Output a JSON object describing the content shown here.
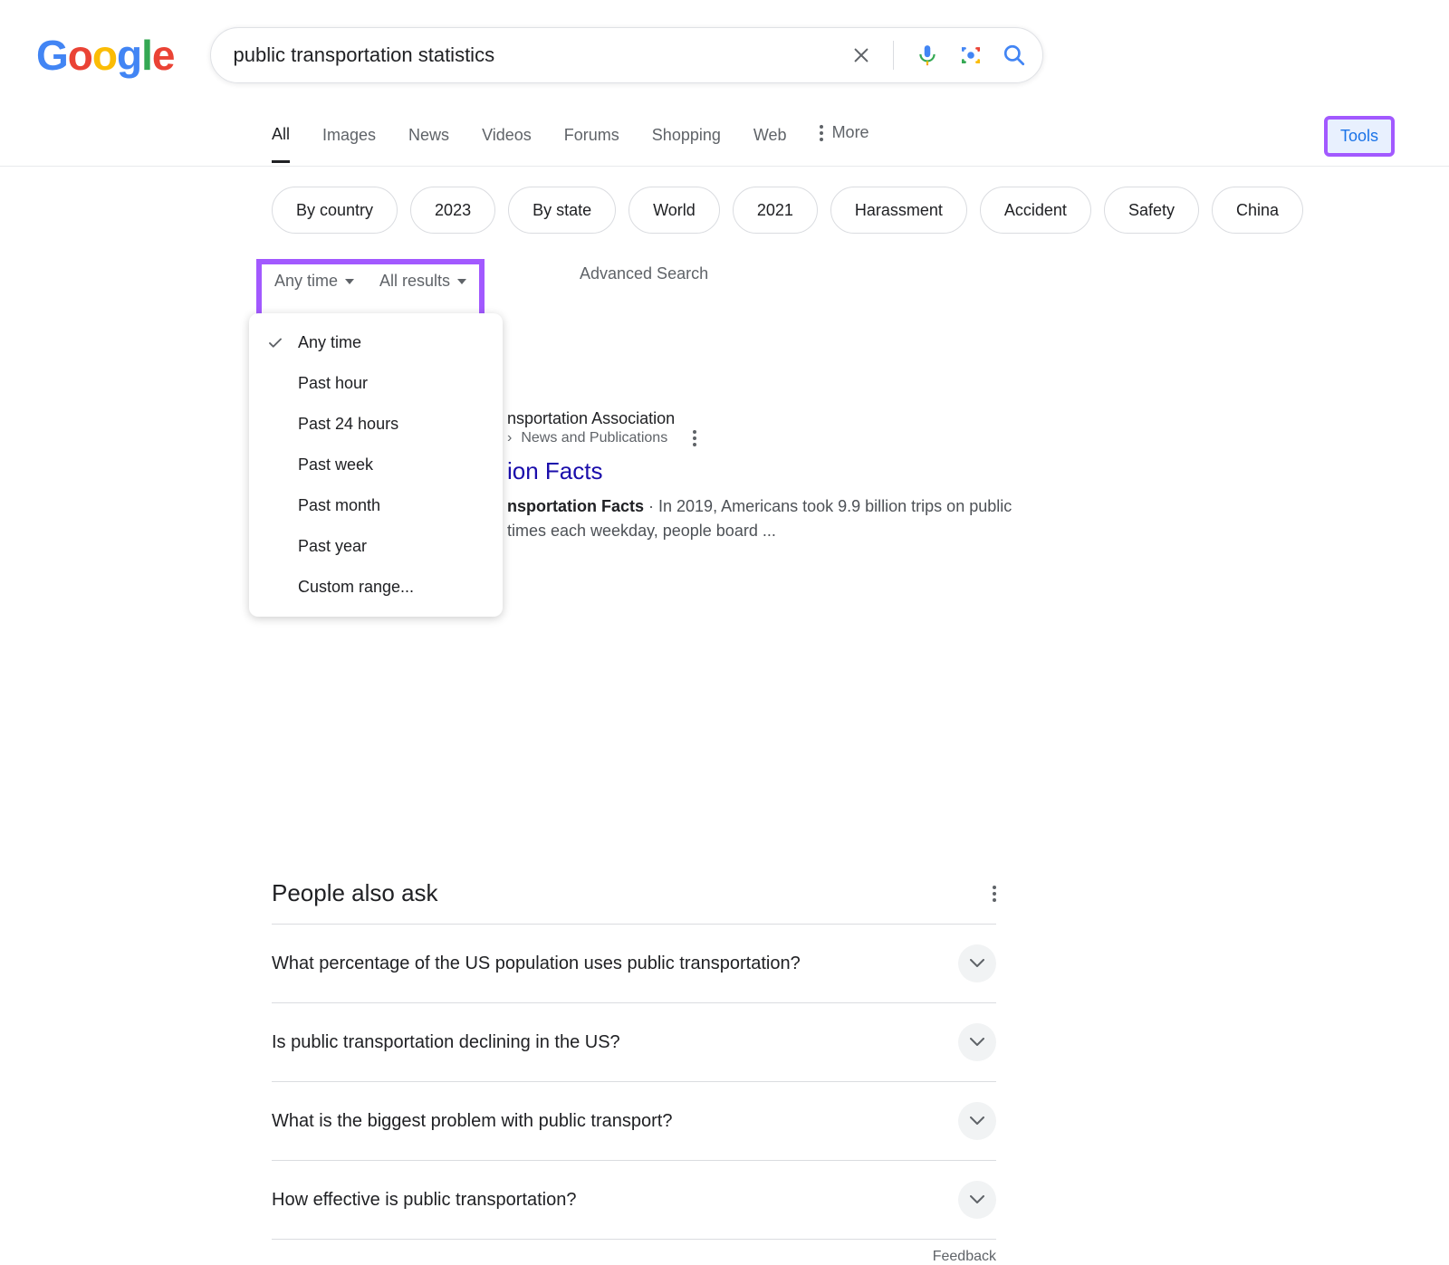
{
  "logo_letters": [
    "G",
    "o",
    "o",
    "g",
    "l",
    "e"
  ],
  "search": {
    "value": "public transportation statistics"
  },
  "tabs": {
    "items": [
      "All",
      "Images",
      "News",
      "Videos",
      "Forums",
      "Shopping",
      "Web"
    ],
    "more": "More",
    "tools": "Tools"
  },
  "chips": [
    "By country",
    "2023",
    "By state",
    "World",
    "2021",
    "Harassment",
    "Accident",
    "Safety",
    "China"
  ],
  "tools_panel": {
    "any_time": "Any time",
    "all_results": "All results",
    "advanced": "Advanced Search",
    "menu": [
      "Any time",
      "Past hour",
      "Past 24 hours",
      "Past week",
      "Past month",
      "Past year",
      "Custom range..."
    ]
  },
  "result": {
    "site_partial": "nsportation Association",
    "breadcrumb_partial": "News and Publications",
    "title_partial": "ion Facts",
    "snip_bold_partial": "nsportation Facts",
    "snip_line1": " · In 2019, Americans took 9.9 billion trips on public",
    "snip_line2_prefix": " times each weekday, people board ..."
  },
  "paa": {
    "title_partial": "People also ask",
    "items": [
      "What percentage of the US population uses public transportation?",
      "Is public transportation declining in the US?",
      "What is the biggest problem with public transport?",
      "How effective is public transportation?"
    ],
    "feedback": "Feedback"
  }
}
